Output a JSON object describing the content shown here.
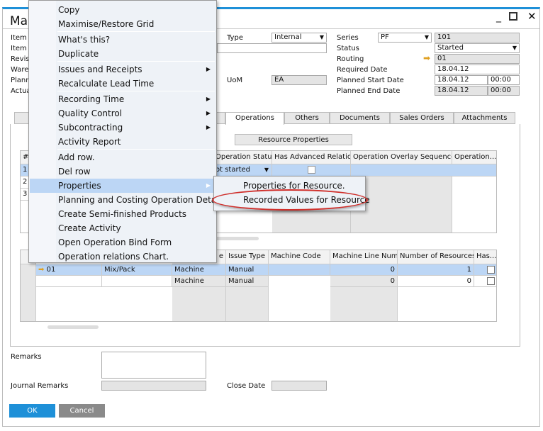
{
  "window": {
    "title": "Mar",
    "controls": [
      "minimize",
      "maximize",
      "close"
    ]
  },
  "header_left": {
    "labels": [
      "Item",
      "Item",
      "Revisi",
      "Ware",
      "Plann",
      "Actua"
    ]
  },
  "header_mid": {
    "type_label": "Type",
    "type_value": "Internal",
    "uom_label": "UoM",
    "uom_value": "EA"
  },
  "header_right": {
    "series_label": "Series",
    "series_value": "PF",
    "series_number": "101",
    "status_label": "Status",
    "status_value": "Started",
    "routing_label": "Routing",
    "routing_value": "01",
    "required_date_label": "Required Date",
    "required_date": "18.04.12",
    "planned_start_label": "Planned Start Date",
    "planned_start_date": "18.04.12",
    "planned_start_time": "00:00",
    "planned_end_label": "Planned End Date",
    "planned_end_date": "18.04.12",
    "planned_end_time": "00:00"
  },
  "tabs": [
    "Operations",
    "Others",
    "Documents",
    "Sales Orders",
    "Attachments"
  ],
  "subtabs": [
    "Resource Properties"
  ],
  "grid1": {
    "columns": [
      "#",
      "Operation Status",
      "Has Advanced Relation",
      "Operation Overlay Sequence",
      "Operation..."
    ],
    "rows": [
      {
        "num": "1",
        "status": "ot started"
      },
      {
        "num": "2"
      },
      {
        "num": "3"
      }
    ]
  },
  "grid2": {
    "columns": [
      "e",
      "Issue Type",
      "Machine Code",
      "Machine Line Num",
      "Number of Resources",
      "Has..."
    ],
    "rows": [
      {
        "code": "01",
        "name": "Mix/Pack",
        "type": "Machine",
        "issue": "Manual",
        "line": "0",
        "count": "1"
      },
      {
        "code": "",
        "name": "",
        "type": "Machine",
        "issue": "Manual",
        "line": "0",
        "count": "0"
      }
    ]
  },
  "footer": {
    "remarks_label": "Remarks",
    "journal_label": "Journal Remarks",
    "close_date_label": "Close Date",
    "ok": "OK",
    "cancel": "Cancel"
  },
  "context_menu": {
    "items": [
      "Copy",
      "Maximise/Restore Grid",
      "What's this?",
      "Duplicate",
      "Issues and Receipts",
      "Recalculate Lead Time",
      "Recording Time",
      "Quality Control",
      "Subcontracting",
      "Activity Report",
      "Add row.",
      "Del row",
      "Properties",
      "Planning and Costing Operation Details",
      "Create Semi-finished Products",
      "Create Activity",
      "Open Operation Bind Form",
      "Operation relations Chart."
    ]
  },
  "submenu": {
    "items": [
      "Properties for Resource.",
      "Recorded Values for Resource"
    ]
  },
  "colors": {
    "accent": "#1e90d8",
    "selection": "#bcd6f5",
    "ok_button": "#1e90d8",
    "cancel_button": "#8a8a8a",
    "highlight_ring": "#d0302c"
  }
}
